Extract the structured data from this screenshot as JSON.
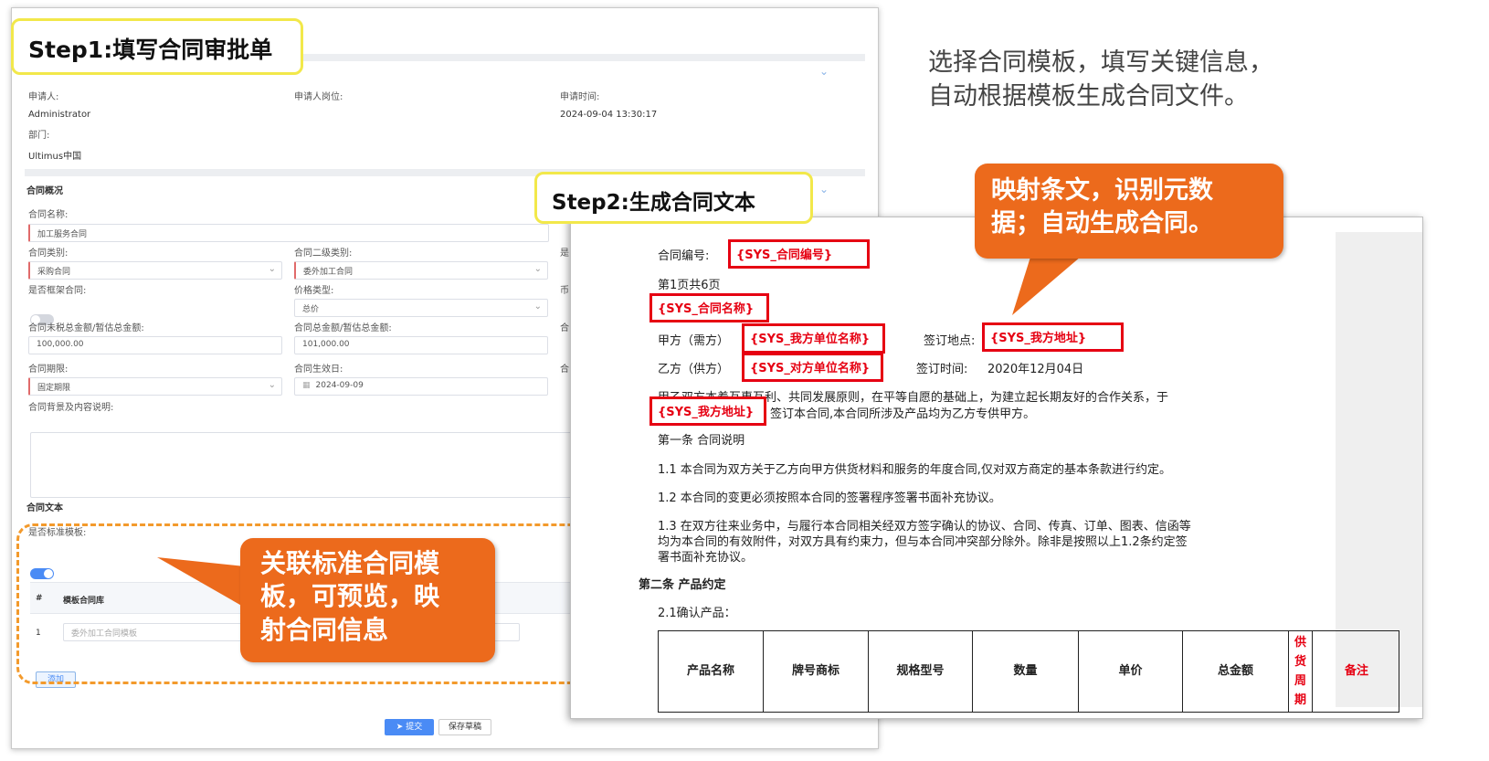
{
  "step1": "Step1:填写合同审批单",
  "step2": "Step2:生成合同文本",
  "description": [
    "选择合同模板，填写关键信息，",
    "自动根据模板生成合同文件。"
  ],
  "callout_map": [
    "映射条文，识别元数",
    "据；自动生成合同。"
  ],
  "callout_link": [
    "关联标准合同模",
    "板，可预览，映",
    "射合同信息"
  ],
  "form": {
    "applicant_label": "申请人:",
    "applicant_value": "Administrator",
    "position_label": "申请人岗位:",
    "time_label": "申请时间:",
    "time_value": "2024-09-04 13:30:17",
    "dept_label": "部门:",
    "dept_value": "Ultimus中国",
    "overview_title": "合同概况",
    "contract_name_label": "合同名称:",
    "contract_name_value": "加工服务合同",
    "type_label": "合同类别:",
    "type_value": "采购合同",
    "subtype_label": "合同二级类别:",
    "subtype_value": "委外加工合同",
    "col3_label_a": "是",
    "framework_label": "是否框架合同:",
    "price_type_label": "价格类型:",
    "price_type_value": "总价",
    "col3_label_b": "币",
    "amount_excl_label": "合同未税总金额/暂估总金额:",
    "amount_excl_value": "100,000.00",
    "amount_total_label": "合同总金额/暂估总金额:",
    "amount_total_value": "101,000.00",
    "col3_label_c": "合",
    "period_label": "合同期限:",
    "period_value": "固定期限",
    "effective_label": "合同生效日:",
    "effective_value": "2024-09-09",
    "col3_label_d": "合",
    "background_label": "合同背景及内容说明:",
    "text_section_title": "合同文本",
    "standard_tpl_label": "是否标准模板:",
    "table_col_index": "#",
    "table_col_library": "模板合同库",
    "row_index": "1",
    "row_template": "委外加工合同模板",
    "add_button": "添加",
    "submit_button": "提交",
    "draft_button": "保存草稿"
  },
  "doc": {
    "contract_no_label": "合同编号:",
    "ph_contract_no": "{SYS_合同编号}",
    "page_info": "第1页共6页",
    "ph_contract_name": "{SYS_合同名称}",
    "party_a_label": "甲方（需方）",
    "ph_our_unit": "{SYS_我方单位名称}",
    "sign_place_label": "签订地点:",
    "ph_our_address": "{SYS_我方地址}",
    "party_b_label": "乙方（供方）",
    "ph_other_unit": "{SYS_对方单位名称}",
    "sign_time_label": "签订时间:",
    "sign_time_value": "2020年12月04日",
    "para1": "甲乙双方本着互惠互利、共同发展原则，在平等自愿的基础上，为建立起长期友好的合作关系，于",
    "ph_our_address_2": "{SYS_我方地址}",
    "para1b": "签订本合同,本合同所涉及产品均为乙方专供甲方。",
    "article1": "第一条 合同说明",
    "c11": "1.1 本合同为双方关于乙方向甲方供货材料和服务的年度合同,仅对双方商定的基本条款进行约定。",
    "c12": "1.2 本合同的变更必须按照本合同的签署程序签署书面补充协议。",
    "c13a": "1.3 在双方往来业务中，与履行本合同相关经双方签字确认的协议、合同、传真、订单、图表、信函等",
    "c13b": "均为本合同的有效附件，对双方具有约束力，但与本合同冲突部分除外。除非是按照以上1.2条约定签",
    "c13c": "署书面补充协议。",
    "article2": "第二条 产品约定",
    "c21": "2.1确认产品：",
    "table_headers": [
      "产品名称",
      "牌号商标",
      "规格型号",
      "数量",
      "单价",
      "总金额"
    ],
    "supply_cycle": "供货周期",
    "remark": "备注"
  },
  "colors": {
    "callout": "#ec6a1c",
    "placeholder_red": "#e60012",
    "step_border": "#f2e84a",
    "dashed": "#f39a2c",
    "accent_blue": "#4a8bf5"
  }
}
